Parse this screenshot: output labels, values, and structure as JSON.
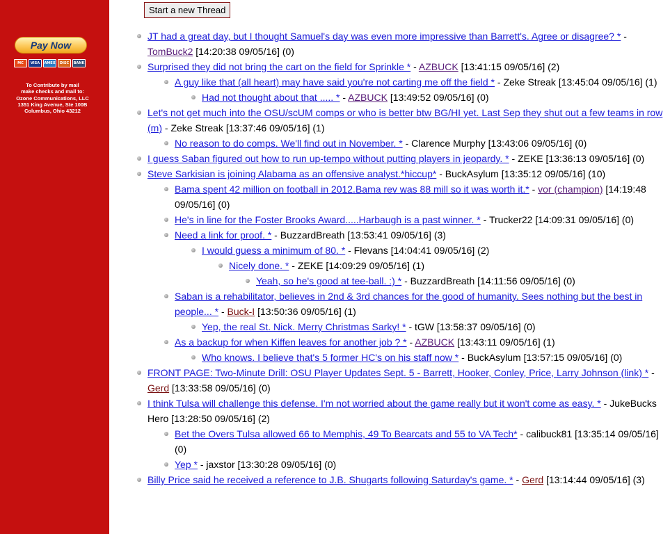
{
  "sidebar": {
    "pay_now_label": "Pay Now",
    "cards": [
      {
        "name": "mastercard",
        "label": "MC",
        "color": "#e64a19"
      },
      {
        "name": "visa",
        "label": "VISA",
        "color": "#1a3b8f"
      },
      {
        "name": "amex",
        "label": "AMEX",
        "color": "#2b7bc4"
      },
      {
        "name": "discover",
        "label": "DISC",
        "color": "#d9661c"
      },
      {
        "name": "bank",
        "label": "BANK",
        "color": "#35507a"
      }
    ],
    "mail_lines": [
      "To Contribute by mail",
      "make checks and mail to:",
      "Ozone Communications, LLC",
      "1351 King Avenue, Ste 100B",
      "Columbus, Ohio 43212"
    ]
  },
  "new_thread_label": "Start a new Thread",
  "posts": [
    {
      "level": 0,
      "title": "JT had a great day, but I thought Samuel's day was even more impressive than Barrett's. Agree or disagree? *",
      "author": "TomBuck2",
      "author_linked": true,
      "timestamp": "[14:20:38 09/05/16]",
      "count": "(0)"
    },
    {
      "level": 0,
      "title": "Surprised they did not bring the cart on the field for Sprinkle *",
      "author": "AZBUCK",
      "author_linked": true,
      "timestamp": "[13:41:15 09/05/16]",
      "count": "(2)"
    },
    {
      "level": 1,
      "title": "A guy like that (all heart) may have said you're not carting me off the field *",
      "author": "Zeke Streak",
      "author_linked": false,
      "timestamp": "[13:45:04 09/05/16]",
      "count": "(1)"
    },
    {
      "level": 2,
      "title": "Had not thought about that ..... *",
      "author": "AZBUCK",
      "author_linked": true,
      "timestamp": "[13:49:52 09/05/16]",
      "count": "(0)"
    },
    {
      "level": 0,
      "title": "Let's not get much into the OSU/scUM comps or who is better btw BG/HI yet. Last Sep they shut out a few teams in row (m)",
      "author": "Zeke Streak",
      "author_linked": false,
      "timestamp": "[13:37:46 09/05/16]",
      "count": "(1)"
    },
    {
      "level": 1,
      "title": "No reason to do comps. We'll find out in November. *",
      "author": "Clarence Murphy",
      "author_linked": false,
      "timestamp": "[13:43:06 09/05/16]",
      "count": "(0)"
    },
    {
      "level": 0,
      "title": "I guess Saban figured out how to run up-tempo without putting players in jeopardy. *",
      "author": "ZEKE",
      "author_linked": false,
      "timestamp": "[13:36:13 09/05/16]",
      "count": "(0)"
    },
    {
      "level": 0,
      "title": "Steve Sarkisian is joining Alabama as an offensive analyst.*hiccup*",
      "author": "BuckAsylum",
      "author_linked": false,
      "timestamp": "[13:35:12 09/05/16]",
      "count": "(10)"
    },
    {
      "level": 1,
      "title": "Bama spent 42 million on football in 2012.Bama rev was 88 mill so it was worth it.*",
      "author": "vor (champion)",
      "author_linked": true,
      "timestamp": "[14:19:48 09/05/16]",
      "count": "(0)"
    },
    {
      "level": 1,
      "title": "He's in line for the Foster Brooks Award.....Harbaugh is a past winner. *",
      "author": "Trucker22",
      "author_linked": false,
      "timestamp": "[14:09:31 09/05/16]",
      "count": "(0)"
    },
    {
      "level": 1,
      "title": "Need a link for proof. *",
      "author": "BuzzardBreath",
      "author_linked": false,
      "timestamp": "[13:53:41 09/05/16]",
      "count": "(3)"
    },
    {
      "level": 2,
      "title": "I would guess a minimum of 80. *",
      "author": "Flevans",
      "author_linked": false,
      "timestamp": "[14:04:41 09/05/16]",
      "count": "(2)"
    },
    {
      "level": 3,
      "title": "Nicely done. *",
      "author": "ZEKE",
      "author_linked": false,
      "timestamp": "[14:09:29 09/05/16]",
      "count": "(1)"
    },
    {
      "level": 4,
      "title": "Yeah, so he's good at tee-ball. :) *",
      "author": "BuzzardBreath",
      "author_linked": false,
      "timestamp": "[14:11:56 09/05/16]",
      "count": "(0)"
    },
    {
      "level": 1,
      "title": "Saban is a rehabilitator, believes in 2nd & 3rd chances for the good of humanity. Sees nothing but the best in people... *",
      "author": "Buck-I",
      "author_linked": true,
      "timestamp": "[13:50:36 09/05/16]",
      "count": "(1)"
    },
    {
      "level": 2,
      "title": "Yep, the real St. Nick. Merry Christmas Sarky! *",
      "author": "tGW",
      "author_linked": false,
      "timestamp": "[13:58:37 09/05/16]",
      "count": "(0)"
    },
    {
      "level": 1,
      "title": "As a backup for when Kiffen leaves for another job ? *",
      "author": "AZBUCK",
      "author_linked": true,
      "timestamp": "[13:43:11 09/05/16]",
      "count": "(1)"
    },
    {
      "level": 2,
      "title": "Who knows. I believe that's 5 former HC's on his staff now *",
      "author": "BuckAsylum",
      "author_linked": false,
      "timestamp": "[13:57:15 09/05/16]",
      "count": "(0)"
    },
    {
      "level": 0,
      "title": "FRONT PAGE: Two-Minute Drill: OSU Player Updates Sept. 5 - Barrett, Hooker, Conley, Price, Larry Johnson (link) *",
      "author": "Gerd",
      "author_linked": true,
      "timestamp": "[13:33:58 09/05/16]",
      "count": "(0)"
    },
    {
      "level": 0,
      "title": "I think Tulsa will challenge this defense. I'm not worried about the game really but it won't come as easy. *",
      "author": "JukeBucks Hero",
      "author_linked": false,
      "timestamp": "[13:28:50 09/05/16]",
      "count": "(2)"
    },
    {
      "level": 1,
      "title": "Bet the Overs Tulsa allowed 66 to Memphis, 49 To Bearcats and 55 to VA Tech*",
      "author": "calibuck81",
      "author_linked": false,
      "timestamp": "[13:35:14 09/05/16]",
      "count": "(0)"
    },
    {
      "level": 1,
      "title": "Yep *",
      "author": "jaxstor",
      "author_linked": false,
      "timestamp": "[13:30:28 09/05/16]",
      "count": "(0)"
    },
    {
      "level": 0,
      "title": "Billy Price said he received a reference to J.B. Shugarts following Saturday's game. *",
      "author": "Gerd",
      "author_linked": true,
      "timestamp": "[13:14:44 09/05/16]",
      "count": "(3)"
    }
  ]
}
